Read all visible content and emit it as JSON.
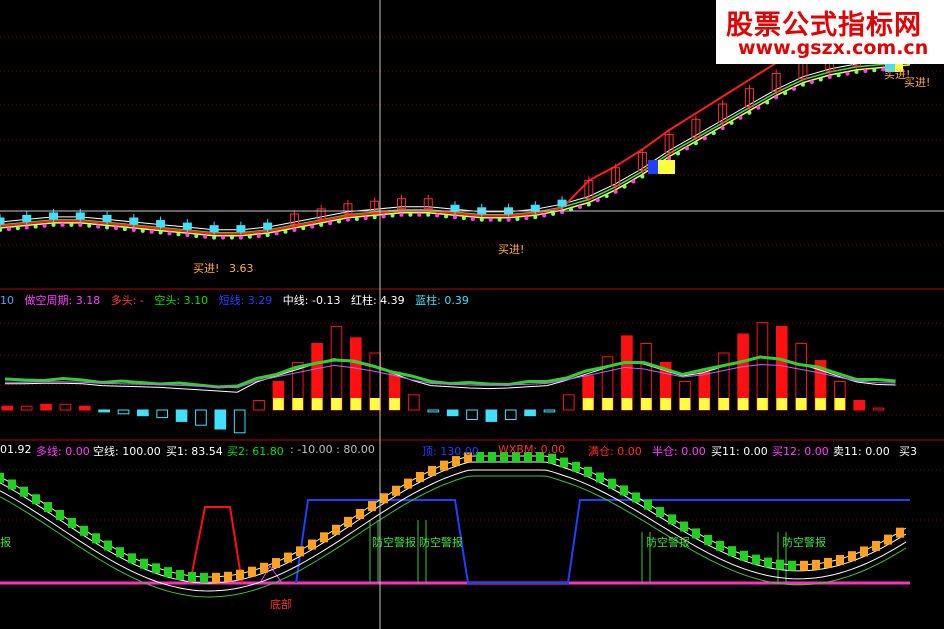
{
  "watermark": {
    "title": "股票公式指标网",
    "url": "www.gszx.com.cn"
  },
  "panel1": {
    "signals": [
      "买进!",
      "买进!",
      "买进!",
      "买进!"
    ],
    "price_note": "3.63"
  },
  "panel2": {
    "legend": [
      {
        "label": "10",
        "color": "#4fa8ff"
      },
      {
        "label": "做空周期: 3.18",
        "color": "#ff40ff"
      },
      {
        "label": "多头: -",
        "color": "#ff4040"
      },
      {
        "label": "空头: 3.10",
        "color": "#00e000"
      },
      {
        "label": "短线: 3.29",
        "color": "#2040ff"
      },
      {
        "label": "中线: -0.13",
        "color": "#ffffff"
      },
      {
        "label": "红柱: 4.39",
        "color": "#ffffff"
      },
      {
        "label": "蓝柱: 0.39",
        "color": "#40e0ff"
      }
    ]
  },
  "panel3": {
    "legend": [
      {
        "label": "01.92",
        "color": "#ffffff"
      },
      {
        "label": "多线: 0.00",
        "color": "#ff40ff"
      },
      {
        "label": "空线: 100.00",
        "color": "#ffffff"
      },
      {
        "label": "买1: 83.54",
        "color": "#ffffff"
      },
      {
        "label": "买2: 61.80",
        "color": "#00e000"
      },
      {
        "label": ": -10.00 : 80.00",
        "color": "#c0c0c0"
      },
      {
        "label": "顶: 130.00",
        "color": "#2040ff"
      },
      {
        "label": "WXBM: 0.00",
        "color": "#ff3030"
      },
      {
        "label": "满仓: 0.00",
        "color": "#ff3030"
      },
      {
        "label": "半仓: 0.00",
        "color": "#ff40ff"
      },
      {
        "label": "买11: 0.00",
        "color": "#ffffff"
      },
      {
        "label": "买12: 0.00",
        "color": "#ff40ff"
      },
      {
        "label": "卖11: 0.00",
        "color": "#ffffff"
      },
      {
        "label": "买3",
        "color": "#ffffff"
      }
    ],
    "alarms": [
      "防空警报",
      "防空警报",
      "防空警报",
      "防空警报"
    ],
    "left_text": "报",
    "bottom_text": "底部"
  },
  "chart_data": {
    "type": "candlestick+indicators",
    "main_trend": [
      20,
      21,
      22,
      22,
      21,
      20,
      19,
      18,
      17,
      17,
      18,
      20,
      22,
      24,
      25,
      26,
      26,
      25,
      24,
      24,
      25,
      27,
      30,
      35,
      41,
      48,
      54,
      60,
      66,
      72,
      77,
      80,
      82,
      83,
      84
    ],
    "macd_bars": [
      0.2,
      0.2,
      0.3,
      0.3,
      0.2,
      -0.1,
      -0.2,
      -0.3,
      -0.4,
      -0.6,
      -0.8,
      -1.0,
      -1.2,
      0.5,
      1.5,
      2.5,
      3.5,
      4.4,
      3.8,
      3.0,
      2.0,
      0.8,
      -0.1,
      -0.3,
      -0.5,
      -0.6,
      -0.5,
      -0.3,
      -0.1,
      0.8,
      1.8,
      2.8,
      3.9,
      3.5,
      2.5,
      1.5,
      2.0,
      3.0,
      4.0,
      4.6,
      4.4,
      3.5,
      2.6,
      1.5,
      0.5,
      0.1,
      0.0
    ]
  }
}
